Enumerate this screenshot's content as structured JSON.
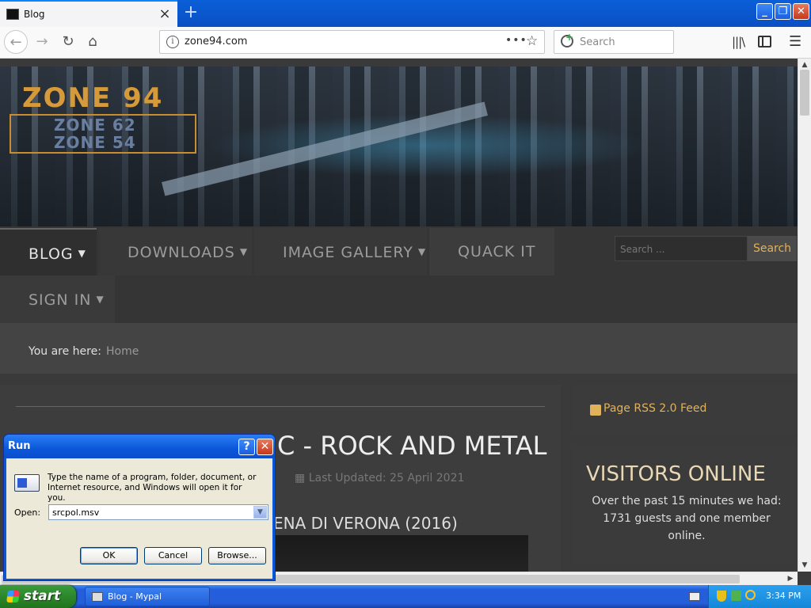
{
  "browser": {
    "tab_title": "Blog",
    "url": "zone94.com",
    "search_placeholder": "Search",
    "page_actions": "•••",
    "window_buttons": {
      "minimize": "_",
      "maximize": "❐",
      "close": "✕"
    },
    "icons": [
      "back-icon",
      "forward-icon",
      "reload-icon",
      "home-icon",
      "info-icon",
      "star-icon",
      "library-icon",
      "sidebar-icon",
      "menu-icon"
    ]
  },
  "site": {
    "logo": {
      "line1": "ZONE 94",
      "line2": "ZONE 62",
      "line3": "ZONE 54"
    },
    "menu": {
      "blog": "BLOG",
      "downloads": "DOWNLOADS",
      "gallery": "IMAGE GALLERY",
      "quack": "QUACK IT",
      "signin": "SIGN IN"
    },
    "search": {
      "placeholder": "Search ...",
      "button": "Search"
    },
    "breadcrumb": {
      "label": "You are here:",
      "home": "Home"
    },
    "article": {
      "title": "C - ROCK AND METAL",
      "updated": "Last Updated: 25 April 2021",
      "subtitle": "ENA DI VERONA (2016)"
    },
    "rss": "Page RSS 2.0 Feed",
    "visitors": {
      "heading": "VISITORS ONLINE",
      "text": "Over the past 15 minutes we had: 1731 guests and one member online."
    }
  },
  "run_dialog": {
    "title": "Run",
    "help": "?",
    "close": "✕",
    "description": "Type the name of a program, folder, document, or Internet resource, and Windows will open it for you.",
    "open_label": "Open:",
    "open_value": "srcpol.msv",
    "ok": "OK",
    "cancel": "Cancel",
    "browse": "Browse..."
  },
  "taskbar": {
    "start": "start",
    "task_item": "Blog - Mypal",
    "clock": "3:34 PM"
  },
  "colors": {
    "xp_blue": "#245edb",
    "start_green": "#2e8b2e",
    "site_accent": "#e1b25a"
  }
}
